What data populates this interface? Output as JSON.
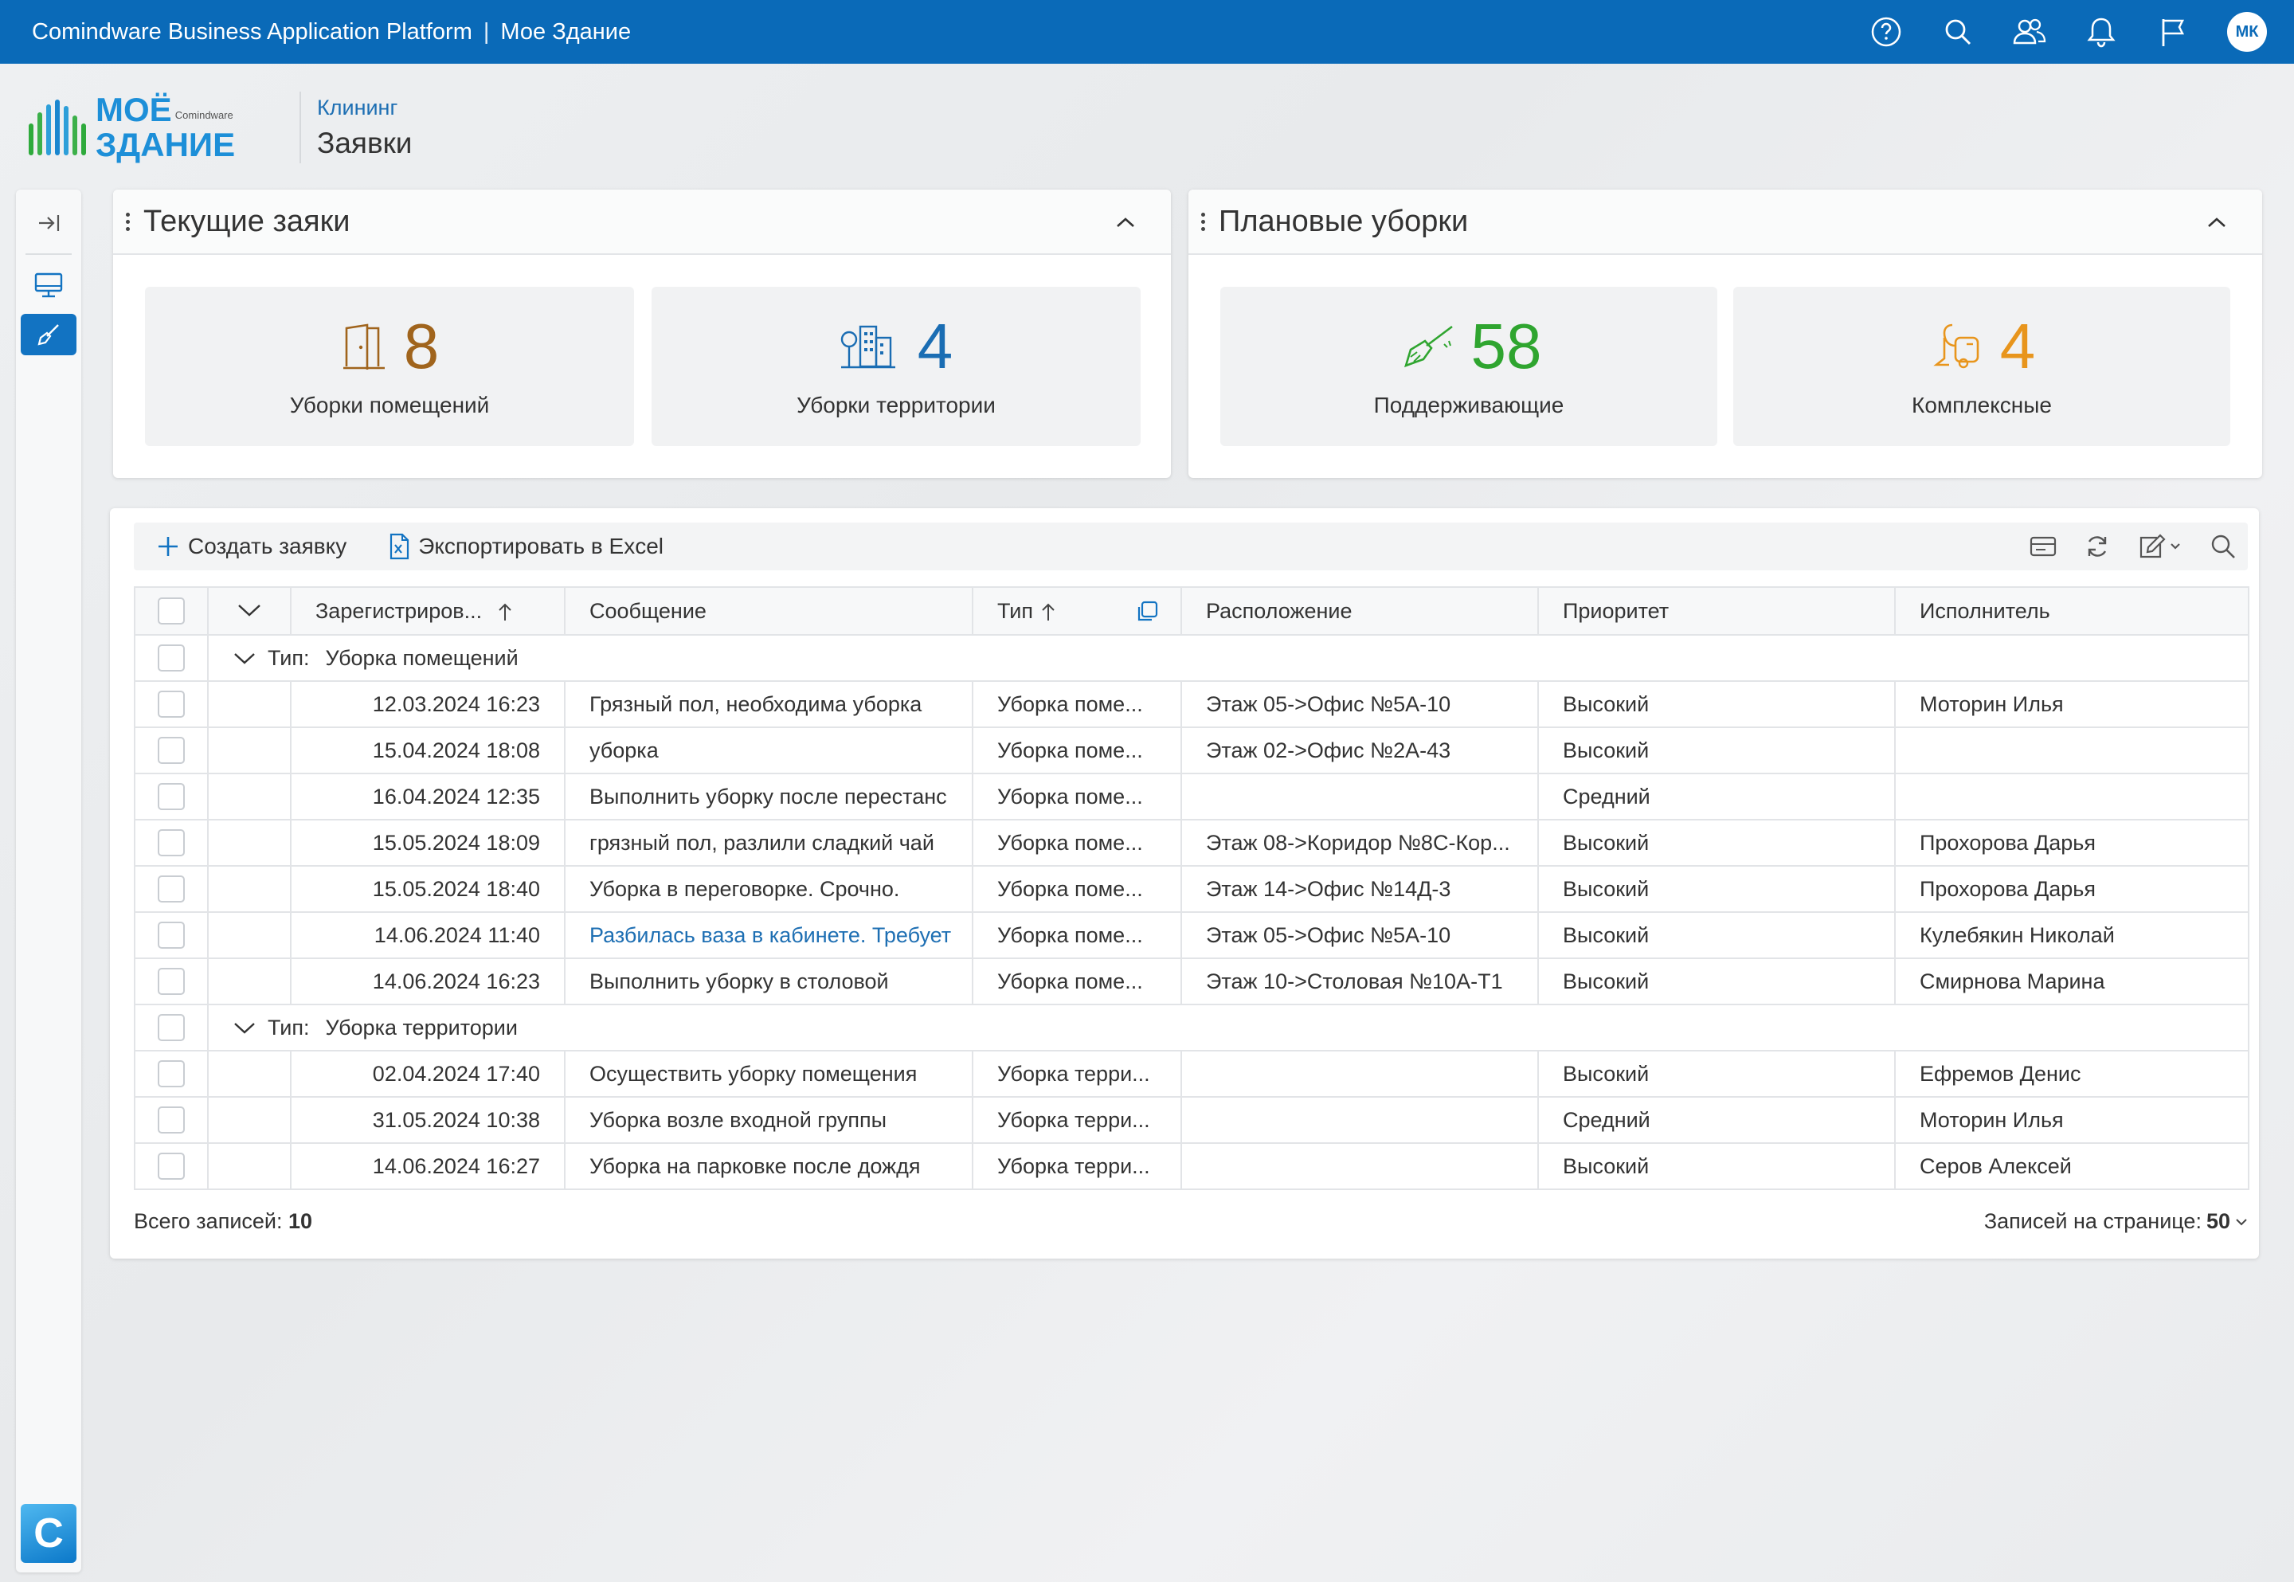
{
  "topbar": {
    "app_title": "Comindware Business Application Platform",
    "separator": "|",
    "app_name": "Мое Здание",
    "avatar_initials": "МК",
    "accent": "#0a6ab8"
  },
  "logo": {
    "line1": "МОЁ",
    "brand": "Comindware",
    "line2": "ЗДАНИЕ"
  },
  "breadcrumb": {
    "parent": "Клининг",
    "current": "Заявки"
  },
  "widgets": [
    {
      "title": "Текущие заяки",
      "tiles": [
        {
          "value": "8",
          "label": "Уборки помещений",
          "icon": "door-icon",
          "color": "#a0641c"
        },
        {
          "value": "4",
          "label": "Уборки территории",
          "icon": "tree-buildings-icon",
          "color": "#1a6db3"
        }
      ]
    },
    {
      "title": "Плановые уборки",
      "tiles": [
        {
          "value": "58",
          "label": "Поддерживающие",
          "icon": "broom-icon",
          "color": "#2fa52f"
        },
        {
          "value": "4",
          "label": "Комплексные",
          "icon": "vacuum-icon",
          "color": "#e8951c"
        }
      ]
    }
  ],
  "toolbar": {
    "create_label": "Создать заявку",
    "export_label": "Экспортировать в Excel"
  },
  "table": {
    "columns": [
      "Зарегистриров...",
      "Сообщение",
      "Тип",
      "Расположение",
      "Приоритет",
      "Исполнитель"
    ],
    "group_key": "Тип:",
    "groups": [
      {
        "name": "Уборка помещений",
        "rows": [
          {
            "date": "12.03.2024 16:23",
            "message": "Грязный пол, необходима уборка",
            "type": "Уборка поме...",
            "location": "Этаж 05->Офис №5А-10",
            "priority": "Высокий",
            "assignee": "Моторин Илья"
          },
          {
            "date": "15.04.2024 18:08",
            "message": "уборка",
            "type": "Уборка поме...",
            "location": "Этаж 02->Офис №2А-43",
            "priority": "Высокий",
            "assignee": ""
          },
          {
            "date": "16.04.2024 12:35",
            "message": "Выполнить уборку после перестанс",
            "type": "Уборка поме...",
            "location": "",
            "priority": "Средний",
            "assignee": ""
          },
          {
            "date": "15.05.2024 18:09",
            "message": "грязный пол, разлили сладкий чай",
            "type": "Уборка поме...",
            "location": "Этаж 08->Коридор №8С-Кор...",
            "priority": "Высокий",
            "assignee": "Прохорова Дарья"
          },
          {
            "date": "15.05.2024 18:40",
            "message": "Уборка в переговорке. Срочно.",
            "type": "Уборка поме...",
            "location": "Этаж 14->Офис №14Д-3",
            "priority": "Высокий",
            "assignee": "Прохорова Дарья"
          },
          {
            "date": "14.06.2024 11:40",
            "message": "Разбилась ваза в кабинете. Требует",
            "type": "Уборка поме...",
            "location": "Этаж 05->Офис №5А-10",
            "priority": "Высокий",
            "assignee": "Кулебякин Николай",
            "link": true
          },
          {
            "date": "14.06.2024 16:23",
            "message": "Выполнить уборку в столовой",
            "type": "Уборка поме...",
            "location": "Этаж 10->Столовая №10А-Т1",
            "priority": "Высокий",
            "assignee": "Смирнова Марина"
          }
        ]
      },
      {
        "name": "Уборка территории",
        "rows": [
          {
            "date": "02.04.2024 17:40",
            "message": "Осуществить уборку помещения",
            "type": "Уборка терри...",
            "location": "",
            "priority": "Высокий",
            "assignee": "Ефремов Денис"
          },
          {
            "date": "31.05.2024 10:38",
            "message": "Уборка возле входной группы",
            "type": "Уборка терри...",
            "location": "",
            "priority": "Средний",
            "assignee": "Моторин Илья"
          },
          {
            "date": "14.06.2024 16:27",
            "message": "Уборка на парковке после дождя",
            "type": "Уборка терри...",
            "location": "",
            "priority": "Высокий",
            "assignee": "Серов Алексей"
          }
        ]
      }
    ]
  },
  "footer": {
    "total_label": "Всего записей:",
    "total_value": "10",
    "per_page_label": "Записей на странице:",
    "per_page_value": "50"
  }
}
